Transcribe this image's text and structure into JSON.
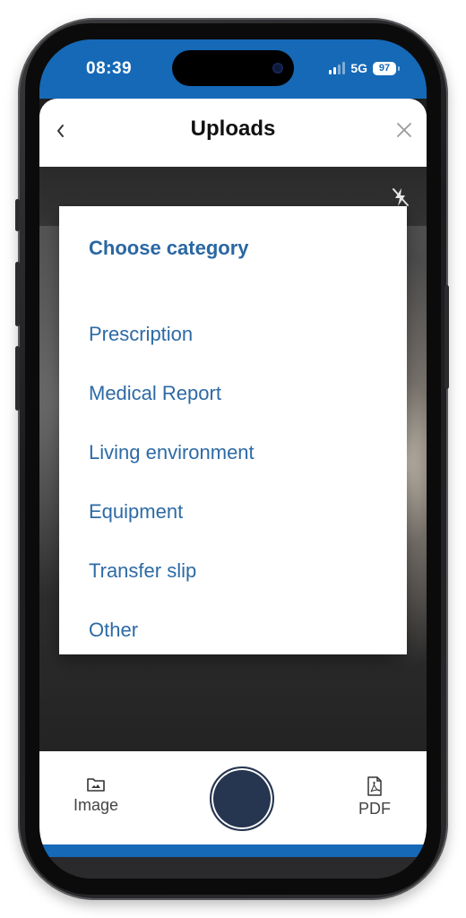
{
  "status_bar": {
    "time": "08:39",
    "network": "5G",
    "battery": "97",
    "color": "#1569b7"
  },
  "header": {
    "title": "Uploads",
    "back_icon": "chevron-left-icon",
    "close_icon": "close-icon"
  },
  "camera": {
    "flash_icon": "flash-off-icon"
  },
  "dialog": {
    "title": "Choose category",
    "options": [
      "Prescription",
      "Medical Report",
      "Living environment",
      "Equipment",
      "Transfer slip",
      "Other"
    ],
    "accent_color": "#2d6aa5"
  },
  "bottom_bar": {
    "image_label": "Image",
    "image_icon": "folder-image-icon",
    "pdf_label": "PDF",
    "pdf_icon": "pdf-file-icon",
    "shutter_icon": "shutter-button"
  }
}
